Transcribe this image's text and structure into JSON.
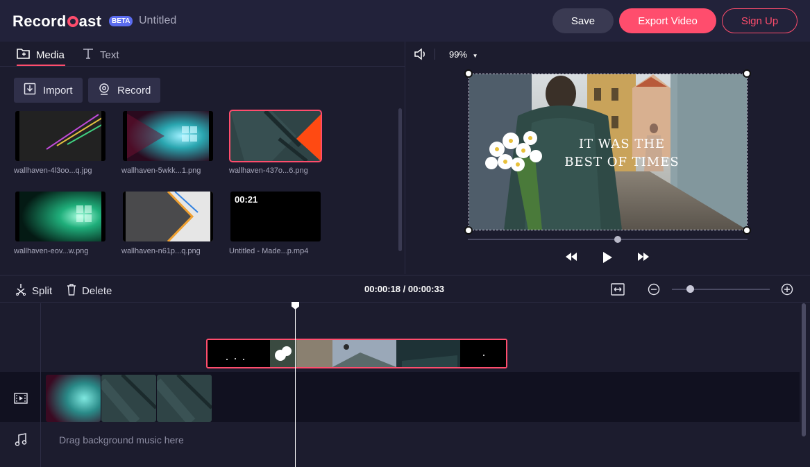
{
  "app": {
    "name": "RecordCast",
    "logo_left": "Record",
    "logo_right": "ast",
    "beta_badge": "BETA",
    "project_title": "Untitled"
  },
  "header": {
    "save_label": "Save",
    "export_label": "Export Video",
    "signup_label": "Sign Up"
  },
  "left_panel": {
    "tabs": [
      {
        "label": "Media",
        "icon": "media-folder-icon",
        "active": true
      },
      {
        "label": "Text",
        "icon": "text-t-icon",
        "active": false
      }
    ],
    "import_label": "Import",
    "record_label": "Record",
    "media_items": [
      {
        "label": "wallhaven-4l3oo...q.jpg"
      },
      {
        "label": "wallhaven-5wkk...1.png"
      },
      {
        "label": "wallhaven-437o...6.png"
      },
      {
        "label": "wallhaven-eov...w.png"
      },
      {
        "label": "wallhaven-n61p...q.png"
      },
      {
        "label": "Untitled - Made...p.mp4",
        "duration": "00:21"
      }
    ]
  },
  "preview": {
    "zoom": "99%",
    "overlay_text_line1": "IT WAS THE",
    "overlay_text_line2": "BEST OF TIMES"
  },
  "timeline": {
    "split_label": "Split",
    "delete_label": "Delete",
    "current_time": "00:00:18",
    "total_time": "00:00:33",
    "music_placeholder": "Drag background music here"
  },
  "colors": {
    "accent": "#ff4d6d",
    "beta": "#5b6cf0",
    "background": "#1c1c2e",
    "header": "#22223a"
  }
}
